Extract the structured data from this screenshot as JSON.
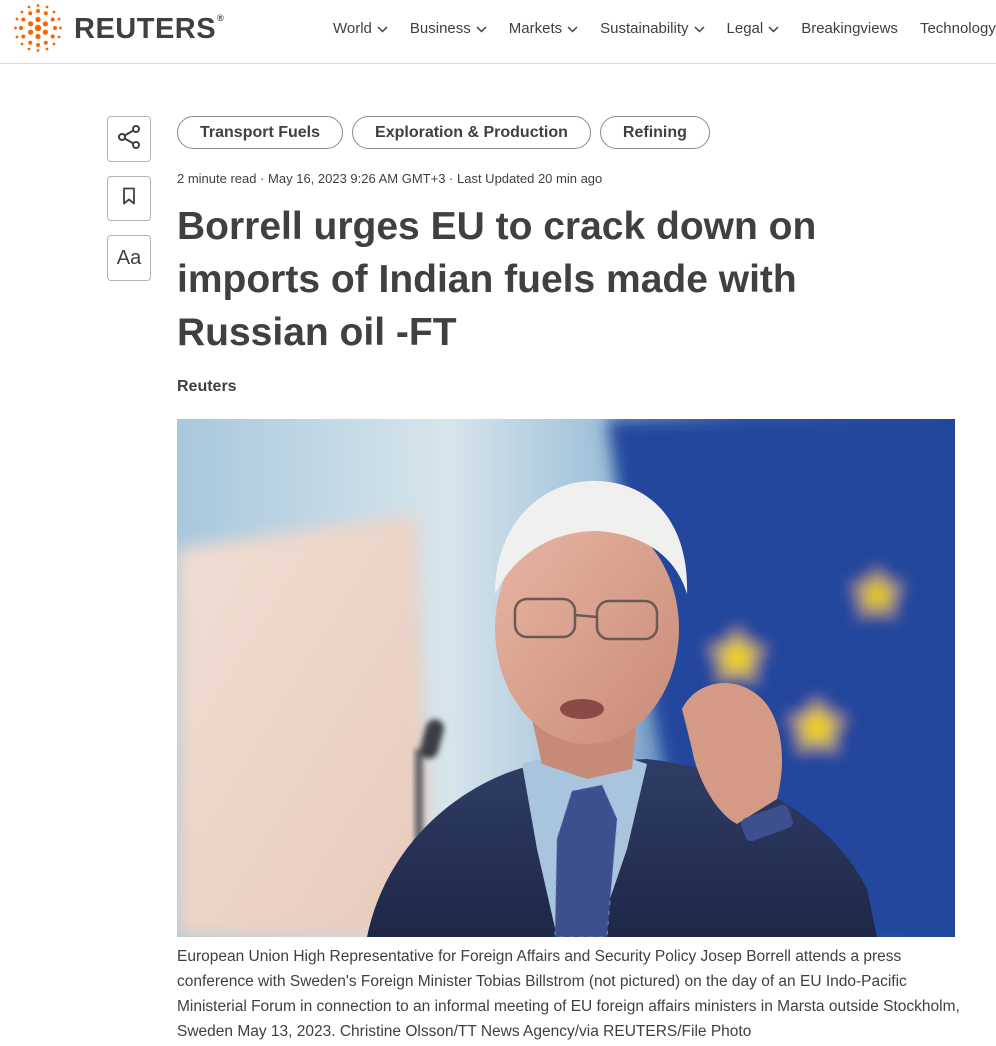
{
  "brand": {
    "name": "REUTERS",
    "registered_mark": "®",
    "logo_color": "#fa6400"
  },
  "nav": {
    "items": [
      {
        "label": "World",
        "has_dropdown": true
      },
      {
        "label": "Business",
        "has_dropdown": true
      },
      {
        "label": "Markets",
        "has_dropdown": true
      },
      {
        "label": "Sustainability",
        "has_dropdown": true
      },
      {
        "label": "Legal",
        "has_dropdown": true
      },
      {
        "label": "Breakingviews",
        "has_dropdown": false
      },
      {
        "label": "Technology",
        "has_dropdown": false
      }
    ]
  },
  "tools": {
    "share_icon": "share-icon",
    "bookmark_icon": "bookmark-icon",
    "text_size_label": "Aa"
  },
  "tags": [
    "Transport Fuels",
    "Exploration & Production",
    "Refining"
  ],
  "article": {
    "meta": "2 minute read · May 16, 2023 9:26 AM GMT+3 · Last Updated 20 min ago",
    "headline": "Borrell urges EU to crack down on imports of Indian fuels made with Russian oil -FT",
    "byline": "Reuters",
    "image_caption": "European Union High Representative for Foreign Affairs and Security Policy Josep Borrell attends a press conference with Sweden's Foreign Minister Tobias Billstrom (not pictured) on the day of an EU Indo-Pacific Ministerial Forum in connection to an informal meeting of EU foreign affairs ministers in Marsta outside Stockholm, Sweden May 13, 2023. Christine Olsson/TT News Agency/via REUTERS/File Photo"
  },
  "colors": {
    "text": "#404040",
    "border": "#d9d9d9",
    "eu_blue": "#21489c",
    "eu_star": "#f2d200"
  }
}
